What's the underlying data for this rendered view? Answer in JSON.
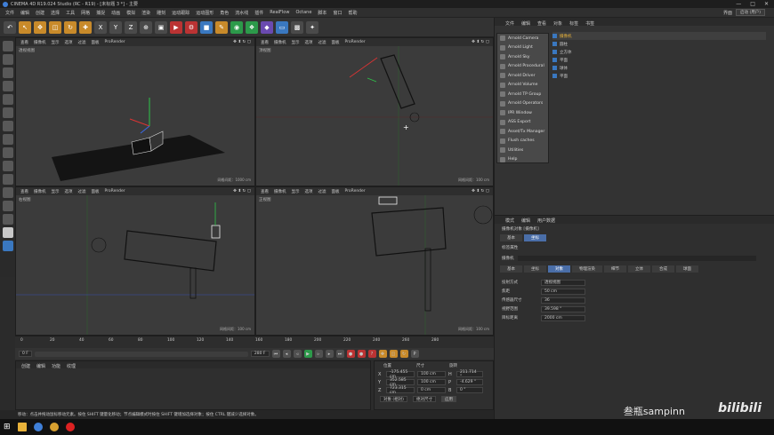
{
  "window": {
    "title": "CINEMA 4D R19.024 Studio (RC - R19) - [未标题 3 *] - 主要",
    "controls": [
      "—",
      "□",
      "✕"
    ]
  },
  "menu": {
    "items": [
      "文件",
      "编辑",
      "创建",
      "选择",
      "工具",
      "网格",
      "捕捉",
      "动画",
      "模拟",
      "渲染",
      "雕刻",
      "运动跟踪",
      "运动图形",
      "角色",
      "流水线",
      "插件",
      "RealFlow",
      "Octane",
      "脚本",
      "窗口",
      "帮助"
    ],
    "layout_label": "界面",
    "layout_value": "启动 (用户)"
  },
  "viewports": [
    {
      "name": "透视视图",
      "menu": [
        "查看",
        "摄像机",
        "显示",
        "选项",
        "过滤",
        "面板",
        "ProRender"
      ],
      "grid": "网格间距：1000 cm"
    },
    {
      "name": "顶视图",
      "menu": [
        "查看",
        "摄像机",
        "显示",
        "选项",
        "过滤",
        "面板",
        "ProRender"
      ],
      "grid": "网格间距：100 cm"
    },
    {
      "name": "右视图",
      "menu": [
        "查看",
        "摄像机",
        "显示",
        "选项",
        "过滤",
        "面板",
        "ProRender"
      ],
      "grid": "网格间距：100 cm"
    },
    {
      "name": "正视图",
      "menu": [
        "查看",
        "摄像机",
        "显示",
        "选项",
        "过滤",
        "面板",
        "ProRender"
      ],
      "grid": "网格间距：100 cm"
    }
  ],
  "arnold_menu": [
    "Arnold Camera",
    "Arnold Light",
    "Arnold Sky",
    "Arnold Procedural",
    "Arnold Driver",
    "Arnold Volume",
    "Arnold TP Group",
    "Arnold Operators",
    "IPR Window",
    "ASS Export",
    "Asset/Tx Manager",
    "Flush caches",
    "Utilities",
    "Help"
  ],
  "objects": {
    "menu": [
      "文件",
      "编辑",
      "查看",
      "对象",
      "标签",
      "书签"
    ],
    "items": [
      "摄像机",
      "圆柱",
      "立方体",
      "平面",
      "球体",
      "平面"
    ]
  },
  "attributes": {
    "menu": [
      "模式",
      "编辑",
      "用户数据"
    ],
    "object_name": "摄像机对象 [摄像机]",
    "tabs_top": [
      "基本",
      "坐标"
    ],
    "section": "标签属性",
    "base_tabs": [
      "基本",
      "坐标",
      "对象",
      "物理渲染",
      "细节",
      "立体",
      "合成",
      "球面"
    ],
    "active_tab": "对象",
    "tag_label": "摄像机",
    "props": [
      {
        "label": "投射方式",
        "value": "透视视图"
      },
      {
        "label": "焦距",
        "value": "50 cm"
      },
      {
        "label": "传感器尺寸",
        "value": "36"
      },
      {
        "label": "视野范围",
        "value": "39.598 °"
      },
      {
        "label": "目标距离",
        "value": "2000 cm"
      }
    ]
  },
  "timeline": {
    "ticks": [
      "0",
      "20",
      "40",
      "60",
      "80",
      "100",
      "120",
      "140",
      "160",
      "180",
      "200",
      "220",
      "240",
      "260",
      "280"
    ],
    "start": "0 F",
    "end": "280 F",
    "current": "0 F"
  },
  "materials": {
    "menu": [
      "创建",
      "编辑",
      "功能",
      "纹理"
    ]
  },
  "coords": {
    "headers": [
      "位置",
      "尺寸",
      "旋转"
    ],
    "rows": [
      [
        "X",
        "-175.455 cm",
        "100 cm",
        "H",
        "211.714 °"
      ],
      [
        "Y",
        "352.585 cm",
        "100 cm",
        "P",
        "-4.629 °"
      ],
      [
        "Z",
        "723.315 cm",
        "0 cm",
        "B",
        "0 °"
      ]
    ],
    "mode": "对象 (相对)",
    "size_mode": "绝对尺寸",
    "apply": "应用"
  },
  "status": "移动：点击并拖动鼠标移动元素。按住 SHIFT 键量化移动；节点编辑模式时按住 SHIFT 键增加选择对象；按住 CTRL 键减少选择对象。",
  "watermark": {
    "author": "叁瓶sampinn",
    "brand": "bilibili"
  },
  "colors": {
    "accent": "#4a6ea8",
    "bg": "#2b2b2b"
  }
}
